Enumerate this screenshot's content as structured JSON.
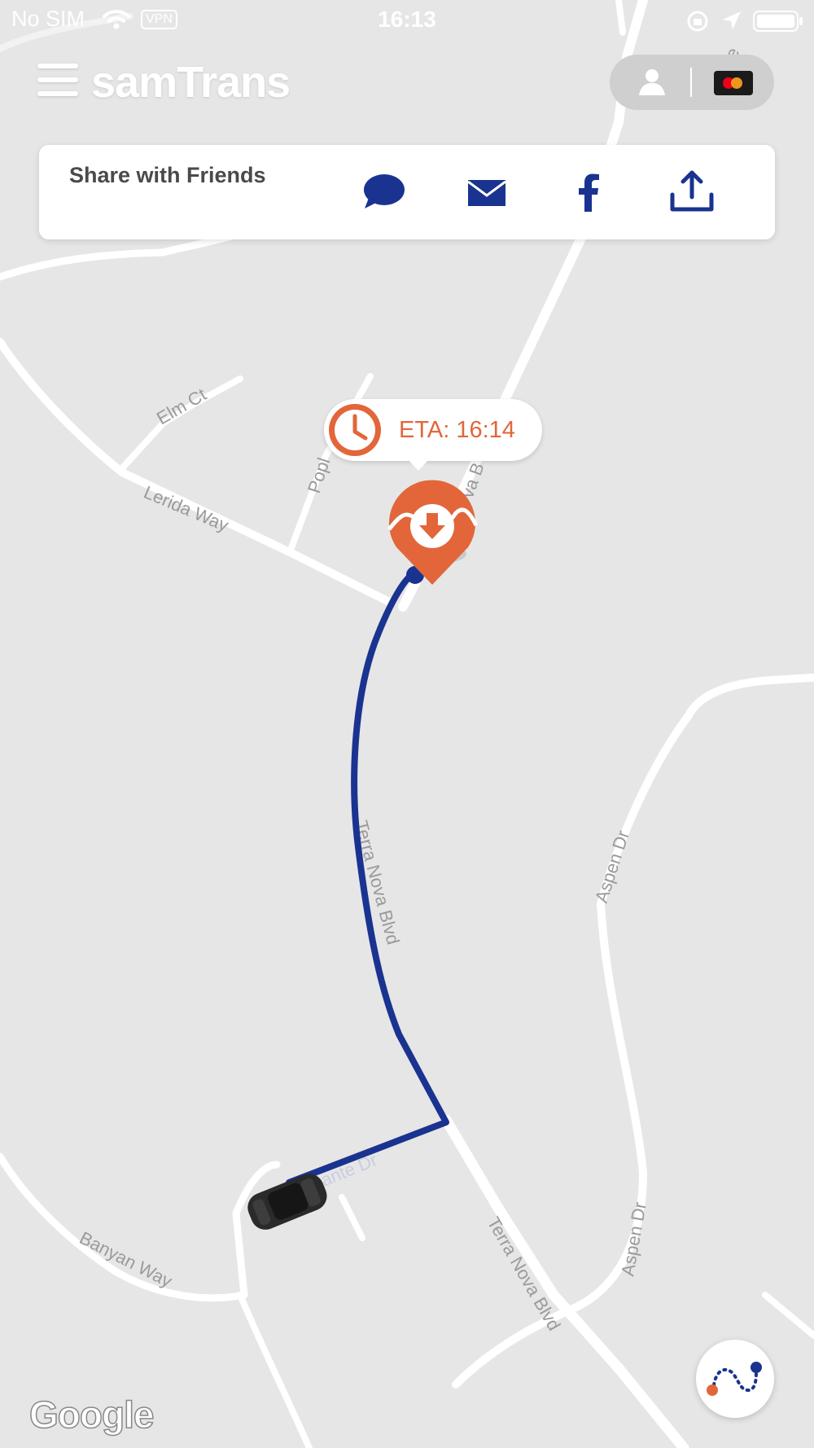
{
  "status_bar": {
    "carrier": "No SIM",
    "vpn": "VPN",
    "time": "16:13"
  },
  "header": {
    "brand": "samTrans",
    "menu_icon": "hamburger-menu-icon",
    "profile_icon": "person-icon",
    "payment_icon": "mastercard-icon"
  },
  "share": {
    "title": "Share with Friends",
    "buttons": [
      {
        "name": "message",
        "icon": "chat-bubble-icon"
      },
      {
        "name": "email",
        "icon": "envelope-icon"
      },
      {
        "name": "facebook",
        "icon": "facebook-icon"
      },
      {
        "name": "share",
        "icon": "share-upload-icon"
      }
    ]
  },
  "map": {
    "eta_label": "ETA: 16:14",
    "street_labels": {
      "elm_ct": "Elm Ct",
      "lerida_way": "Lerida Way",
      "poplar": "Popl",
      "terra_nova_top": "va B",
      "terra_nova_route": "Terra Nova Blvd",
      "aspen_dr_upper": "Aspen Dr",
      "aspen_dr_lower": "Aspen Dr",
      "cante_dr": "ante Dr",
      "terra_nova_lower": "Terra Nova Blvd",
      "banyan_way": "Banyan Way",
      "esplanade": "Es     ade"
    },
    "attribution": "Google"
  },
  "colors": {
    "route": "#1a3390",
    "accent": "#e2663a",
    "map_bg": "#e6e6e6",
    "road": "#ffffff"
  }
}
